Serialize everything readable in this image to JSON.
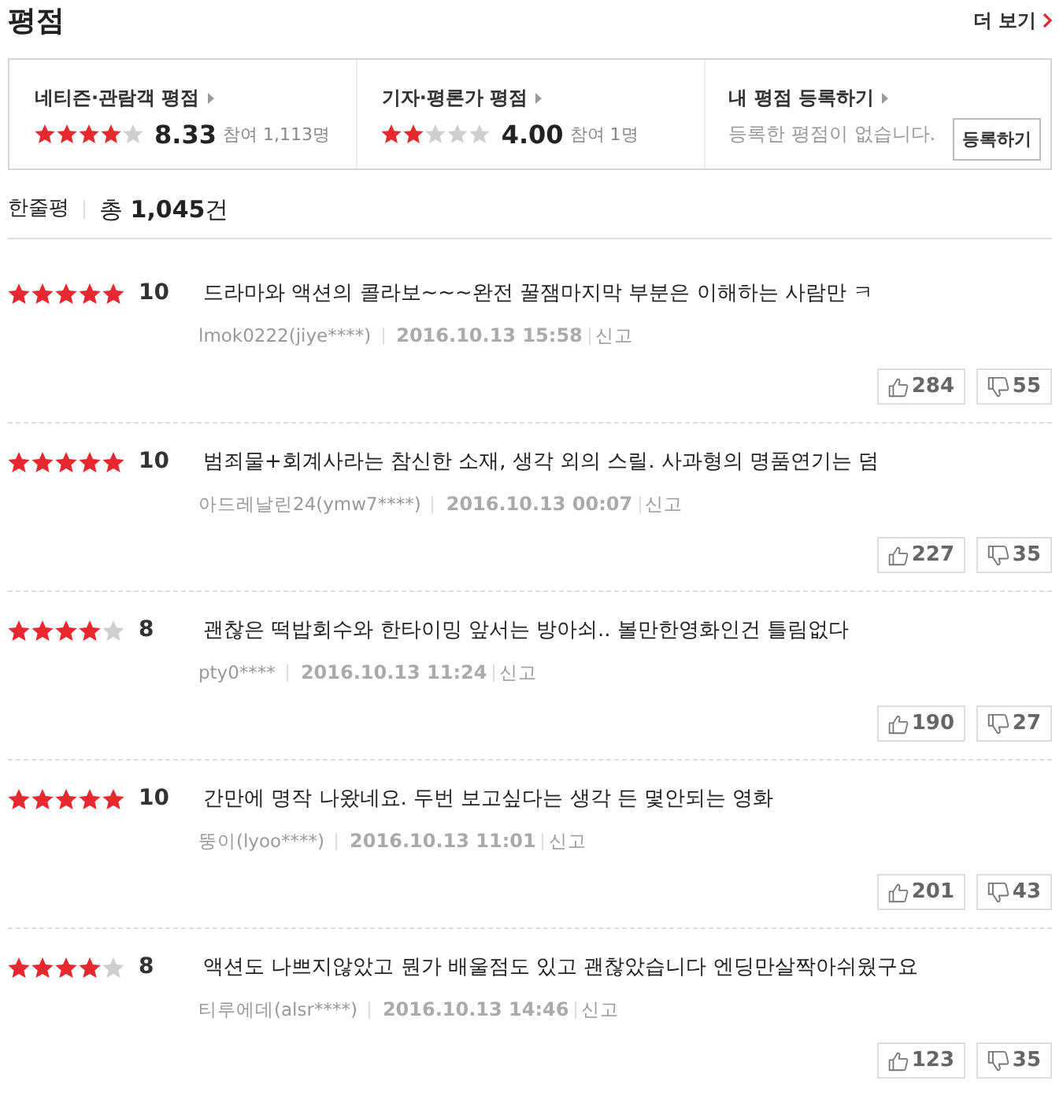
{
  "header": {
    "title": "평점",
    "more_link": "더 보기"
  },
  "summary": [
    {
      "kind": "rating",
      "label": "네티즌·관람객 평점",
      "stars": 4,
      "score": "8.33",
      "participants": "참여 1,113명"
    },
    {
      "kind": "rating",
      "label": "기자·평론가 평점",
      "stars": 2,
      "score": "4.00",
      "participants": "참여 1명"
    },
    {
      "kind": "register",
      "label": "내 평점 등록하기",
      "message": "등록한 평점이 없습니다.",
      "button": "등록하기"
    }
  ],
  "reviews_header": {
    "title": "한줄평",
    "total": "총 **1,045**건"
  },
  "reviews": [
    {
      "stars": 5,
      "score": "10",
      "text": "드라마와 액션의 콜라보~~~완전 꿀잼마지막 부분은 이해하는 사람만 ㅋ",
      "author": "lmok0222(jiye****)",
      "date": "2016.10.13 15:58",
      "report": "신고",
      "likes": "284",
      "dislikes": "55"
    },
    {
      "stars": 5,
      "score": "10",
      "text": "범죄물+회계사라는 참신한 소재, 생각 외의 스릴. 사과형의 명품연기는 덤",
      "author": "아드레날린24(ymw7****)",
      "date": "2016.10.13 00:07",
      "report": "신고",
      "likes": "227",
      "dislikes": "35"
    },
    {
      "stars": 4,
      "score": "8",
      "text": "괜찮은 떡밥회수와 한타이밍 앞서는 방아쇠.. 볼만한영화인건 틀림없다",
      "author": "pty0****",
      "date": "2016.10.13 11:24",
      "report": "신고",
      "likes": "190",
      "dislikes": "27"
    },
    {
      "stars": 5,
      "score": "10",
      "text": "간만에 명작 나왔네요. 두번 보고싶다는 생각 든 몇안되는 영화",
      "author": "뚱이(lyoo****)",
      "date": "2016.10.13 11:01",
      "report": "신고",
      "likes": "201",
      "dislikes": "43"
    },
    {
      "stars": 4,
      "score": "8",
      "text": "액션도 나쁘지않았고 뭔가 배울점도 있고 괜찮았습니다 엔딩만살짝아쉬웠구요",
      "author": "티루에데(alsr****)",
      "date": "2016.10.13 14:46",
      "report": "신고",
      "likes": "123",
      "dislikes": "35"
    }
  ]
}
